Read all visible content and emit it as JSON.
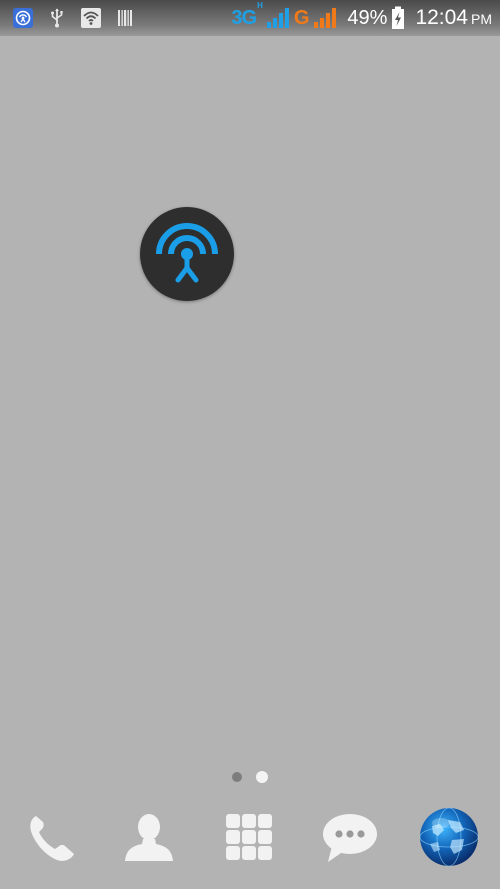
{
  "status_bar": {
    "left_icons": [
      "hotspot-status-icon",
      "usb-icon",
      "wifi-icon",
      "barcode-icon"
    ],
    "network_3g": "3G",
    "network_3g_sub": "H",
    "network_g": "G",
    "battery_percent": "49%",
    "time": "12:04",
    "ampm": "PM",
    "colors": {
      "sim1": "#1fa0e6",
      "sim2": "#f07a1a"
    }
  },
  "home": {
    "widget_icon": "wifi-hotspot-icon",
    "widget_color": "#1a9ee8",
    "pages": 2,
    "current_page": 2
  },
  "dock": {
    "items": [
      "phone-icon",
      "contacts-icon",
      "app-drawer-icon",
      "messaging-icon",
      "browser-globe-icon"
    ]
  }
}
